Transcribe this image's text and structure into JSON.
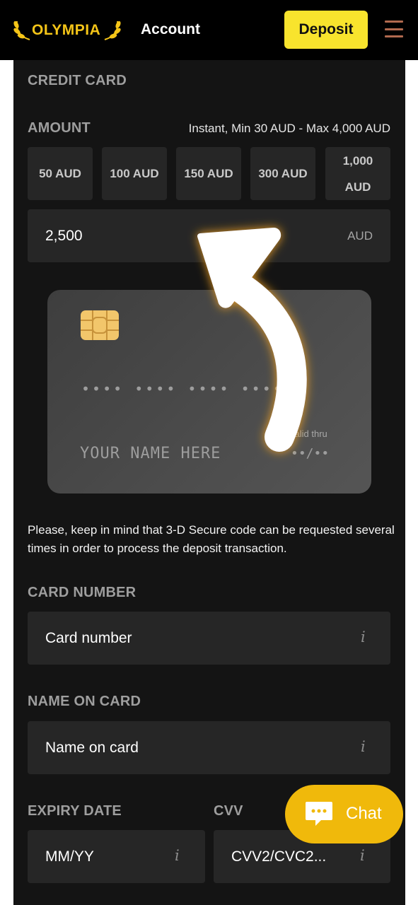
{
  "header": {
    "logo_text": "OLYMPIA",
    "title": "Account",
    "deposit_label": "Deposit",
    "menu_icon": "hamburger-menu-icon"
  },
  "payment": {
    "method_title": "CREDIT CARD",
    "amount_label": "AMOUNT",
    "limits_text": "Instant, Min 30 AUD - Max 4,000 AUD",
    "presets": [
      "50 AUD",
      "100 AUD",
      "150 AUD",
      "300 AUD",
      "1,000 AUD"
    ],
    "amount_value": "2,500",
    "currency": "AUD"
  },
  "card_preview": {
    "number_mask": "•••• •••• •••• ••••",
    "valid_thru_label": "valid thru",
    "name_placeholder": "YOUR NAME HERE",
    "expiry_mask": "••/••"
  },
  "notice_text": "Please, keep in mind that 3-D Secure code can be requested several times in order to process the deposit transaction.",
  "form": {
    "card_number_label": "CARD NUMBER",
    "card_number_placeholder": "Card number",
    "name_label": "NAME ON CARD",
    "name_placeholder": "Name on card",
    "expiry_label": "EXPIRY DATE",
    "expiry_placeholder": "MM/YY",
    "cvv_label": "CVV",
    "cvv_placeholder": "CVV2/CVC2...",
    "info_glyph": "i"
  },
  "chat": {
    "label": "Chat",
    "icon": "chat-bubble-icon"
  },
  "colors": {
    "accent_yellow": "#f8e42d",
    "chat_yellow": "#f0b90b",
    "panel_bg": "#141414",
    "field_bg": "#262626"
  }
}
